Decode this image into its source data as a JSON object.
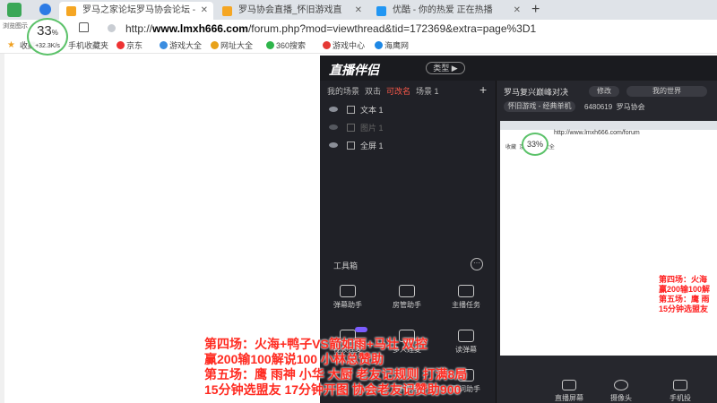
{
  "browser": {
    "tabs": [
      {
        "label": "罗马之家论坛罗马协会论坛 -",
        "active": true,
        "favicon_color": "#f5a623"
      },
      {
        "label": "罗马协会直播_怀旧游戏直",
        "active": false,
        "favicon_color": "#f5a623"
      },
      {
        "label": "优酷 - 你的热爱 正在热播",
        "active": false,
        "favicon_color": "#2196f3"
      }
    ],
    "url_prefix": "http://",
    "url_host": "www.lmxh666.com",
    "url_path": "/forum.php?mod=viewthread&tid=172369&extra=page%3D1",
    "bookmarks": [
      "收藏",
      "手机收藏夹",
      "京东",
      "游戏大全",
      "网址大全",
      "360搜索",
      "游戏中心",
      "海鹰网"
    ],
    "side_label": "浏览图示",
    "speed_widget": {
      "percent": "33",
      "unit": "%",
      "speed": "+32.3K/s"
    }
  },
  "app": {
    "logo": "直播伴侣",
    "logo_pill": "类型 ▶",
    "scene_tabs": [
      "我的场景",
      "双击",
      "可改名",
      "场景 1"
    ],
    "active_scene_tab": 2,
    "sources": [
      {
        "label": "文本 1",
        "dim": false
      },
      {
        "label": "图片 1",
        "dim": true
      },
      {
        "label": "全屏 1",
        "dim": false
      }
    ],
    "toolbox_title": "工具箱",
    "tools": [
      "弹幕助手",
      "房管助手",
      "主播任务",
      "视频连麦",
      "多人连麦",
      "读弹幕",
      "弹幕秀",
      "歌词助手"
    ],
    "preview": {
      "title": "罗马复兴巅峰对决",
      "modify": "修改",
      "world": "我的世界",
      "category": "怀旧游戏 - 经典单机",
      "room_name": "罗马协会",
      "room_id": "6480619",
      "mini_url": "http://www.lmxh666.com/forum",
      "mini_percent": "33%",
      "mini_overlay": [
        "第四场：火海",
        "赢200输100解",
        "第五场：鹰 雨",
        "15分钟选盟友"
      ]
    },
    "bottom_bar": [
      "直播屏幕",
      "摄像头",
      "手机投"
    ]
  },
  "overlay_text": [
    "第四场：火海+鸭子VS箭如雨+马壮 双控",
    "赢200输100解说100 小林总赞助",
    "第五场：鹰 雨神 小华 大厨 老友记规则 打满8局",
    "15分钟选盟友 17分钟开图  协会老友记赞助900"
  ]
}
